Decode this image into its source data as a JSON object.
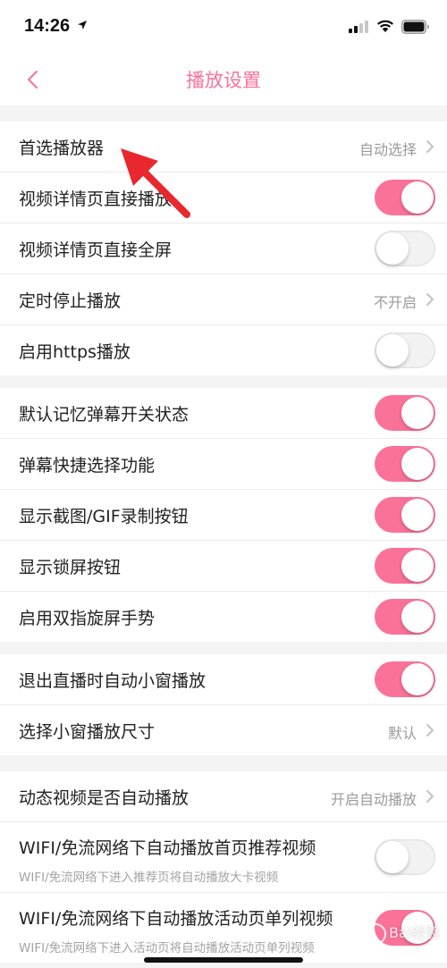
{
  "status_bar": {
    "time": "14:26"
  },
  "nav": {
    "title": "播放设置"
  },
  "groups": [
    {
      "rows": [
        {
          "label": "首选播放器",
          "value": "自动选择"
        },
        {
          "label": "视频详情页直接播放",
          "toggle": true
        },
        {
          "label": "视频详情页直接全屏",
          "toggle": false
        },
        {
          "label": "定时停止播放",
          "value": "不开启"
        },
        {
          "label": "启用https播放",
          "toggle": false
        }
      ]
    },
    {
      "rows": [
        {
          "label": "默认记忆弹幕开关状态",
          "toggle": true
        },
        {
          "label": "弹幕快捷选择功能",
          "toggle": true
        },
        {
          "label": "显示截图/GIF录制按钮",
          "toggle": true
        },
        {
          "label": "显示锁屏按钮",
          "toggle": true
        },
        {
          "label": "启用双指旋屏手势",
          "toggle": true
        }
      ]
    },
    {
      "rows": [
        {
          "label": "退出直播时自动小窗播放",
          "toggle": true
        },
        {
          "label": "选择小窗播放尺寸",
          "value": "默认"
        }
      ]
    },
    {
      "rows": [
        {
          "label": "动态视频是否自动播放",
          "value": "开启自动播放"
        },
        {
          "label": "WIFI/免流网络下自动播放首页推荐视频",
          "sub": "WIFI/免流网络下进入推荐页将自动播放大卡视频",
          "toggle": false
        },
        {
          "label": "WIFI/免流网络下自动播放活动页单列视频",
          "sub": "WIFI/免流网络下进入活动页将自动播放活动页单列视频",
          "toggle": true
        }
      ]
    }
  ],
  "watermark": {
    "text": "Bai经验"
  },
  "colors": {
    "accent": "#fb7299",
    "annotation": "#e8272e"
  }
}
